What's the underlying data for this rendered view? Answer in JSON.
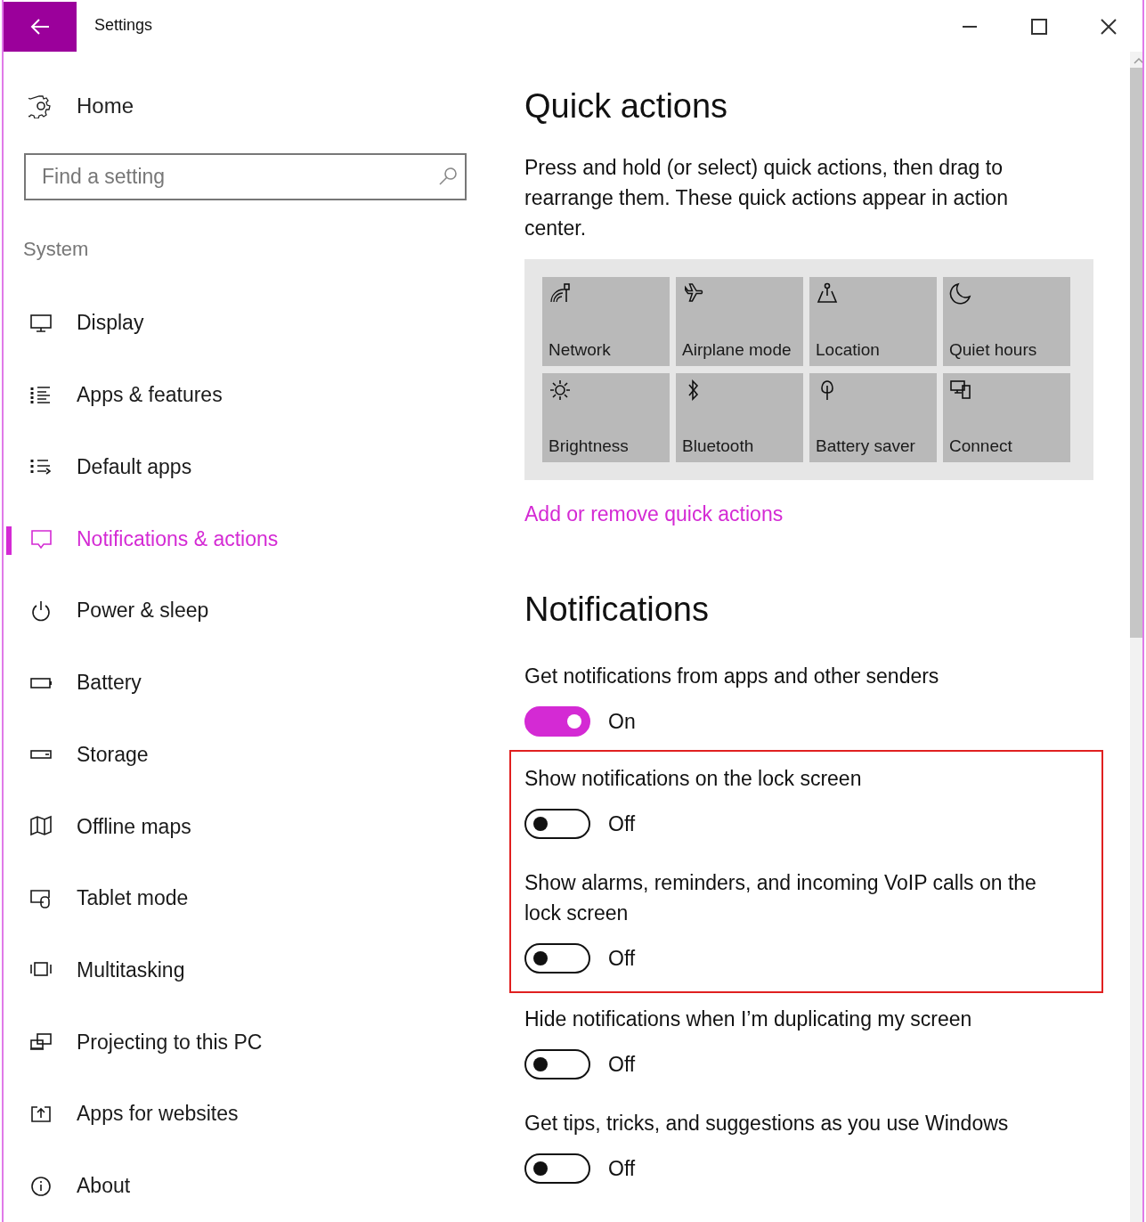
{
  "window": {
    "title": "Settings"
  },
  "sidebar": {
    "home": "Home",
    "search": {
      "placeholder": "Find a setting"
    },
    "section": "System",
    "items": [
      {
        "label": "Display",
        "selected": false
      },
      {
        "label": "Apps & features",
        "selected": false
      },
      {
        "label": "Default apps",
        "selected": false
      },
      {
        "label": "Notifications & actions",
        "selected": true
      },
      {
        "label": "Power & sleep",
        "selected": false
      },
      {
        "label": "Battery",
        "selected": false
      },
      {
        "label": "Storage",
        "selected": false
      },
      {
        "label": "Offline maps",
        "selected": false
      },
      {
        "label": "Tablet mode",
        "selected": false
      },
      {
        "label": "Multitasking",
        "selected": false
      },
      {
        "label": "Projecting to this PC",
        "selected": false
      },
      {
        "label": "Apps for websites",
        "selected": false
      },
      {
        "label": "About",
        "selected": false
      }
    ]
  },
  "quick_actions": {
    "heading": "Quick actions",
    "description": "Press and hold (or select) quick actions, then drag to rearrange them. These quick actions appear in action center.",
    "tiles": [
      {
        "label": "Network"
      },
      {
        "label": "Airplane mode"
      },
      {
        "label": "Location"
      },
      {
        "label": "Quiet hours"
      },
      {
        "label": "Brightness"
      },
      {
        "label": "Bluetooth"
      },
      {
        "label": "Battery saver"
      },
      {
        "label": "Connect"
      }
    ],
    "link": "Add or remove quick actions"
  },
  "notifications": {
    "heading": "Notifications",
    "settings": [
      {
        "label": "Get notifications from apps and other senders",
        "on": true,
        "state": "On",
        "highlighted": false
      },
      {
        "label": "Show notifications on the lock screen",
        "on": false,
        "state": "Off",
        "highlighted": true
      },
      {
        "label": "Show alarms, reminders, and incoming VoIP calls on the lock screen",
        "on": false,
        "state": "Off",
        "highlighted": true
      },
      {
        "label": "Hide notifications when I’m duplicating my screen",
        "on": false,
        "state": "Off",
        "highlighted": false
      },
      {
        "label": "Get tips, tricks, and suggestions as you use Windows",
        "on": false,
        "state": "Off",
        "highlighted": false
      }
    ]
  }
}
